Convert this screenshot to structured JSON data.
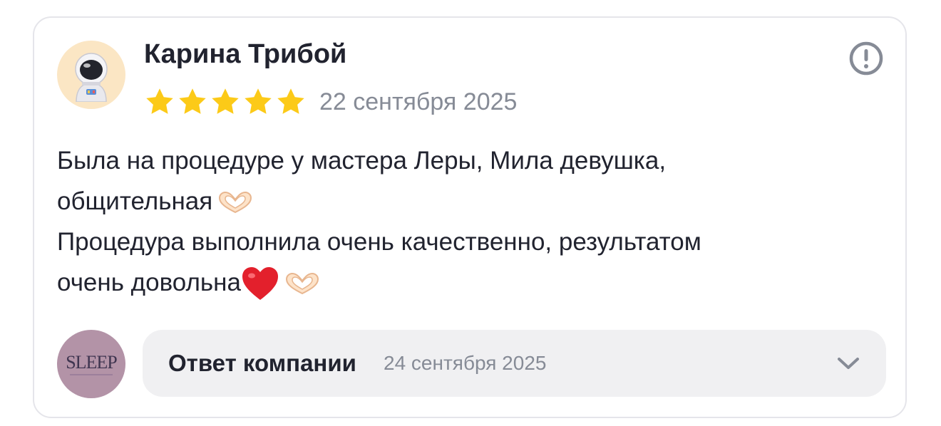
{
  "review": {
    "author_name": "Карина Трибой",
    "avatar_icon": "astronaut-icon",
    "rating": 5,
    "rating_max": 5,
    "star_color": "#fcca18",
    "date": "22 сентября 2025",
    "report_icon": "exclamation-circle-icon",
    "text_lines": [
      "Была на процедуре у мастера Леры, Мила девушка,",
      "общительная",
      "Процедура выполнила очень качественно, результатом",
      "очень довольна"
    ],
    "emojis": {
      "line2": "heart-hands-emoji",
      "line4": [
        "red-heart-emoji",
        "heart-hands-emoji"
      ]
    }
  },
  "company_reply": {
    "logo_text": "SLEEP",
    "logo_color": "#b393a7",
    "label": "Ответ компании",
    "date": "24 сентября 2025",
    "expand_icon": "chevron-down-icon"
  }
}
